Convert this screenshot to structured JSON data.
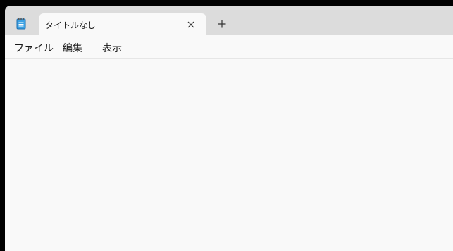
{
  "window": {
    "tab": {
      "title": "タイトルなし",
      "icon": "notepad-icon",
      "close_icon": "close-icon"
    },
    "new_tab_icon": "plus-icon"
  },
  "menu": {
    "items": [
      {
        "label": "ファイル"
      },
      {
        "label": "編集"
      },
      {
        "label": "表示"
      }
    ]
  },
  "editor": {
    "content": ""
  },
  "colors": {
    "titlebar": "#dcdcdc",
    "content_bg": "#f9f9f9",
    "notepad_icon_blue": "#2b8fd6"
  }
}
